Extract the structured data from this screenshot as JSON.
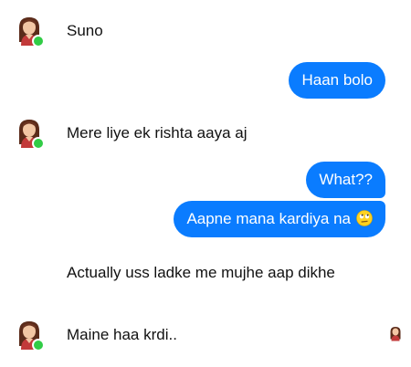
{
  "conversation": {
    "messages": [
      {
        "from": "them",
        "text": "Suno"
      },
      {
        "from": "me",
        "text": "Haan bolo"
      },
      {
        "from": "them",
        "text": "Mere liye ek rishta aaya aj"
      },
      {
        "from": "me",
        "text": "What??"
      },
      {
        "from": "me",
        "text": "Aapne mana kardiya na",
        "emoji": "face-with-rolling-eyes"
      },
      {
        "from": "them",
        "text": "Actually uss ladke me mujhe aap dikhe"
      },
      {
        "from": "them",
        "text": "Maine haa krdi.."
      }
    ]
  },
  "colors": {
    "outgoing_bubble": "#0a7cff",
    "outgoing_text": "#ffffff",
    "incoming_text": "#111111",
    "online_dot": "#31cc46",
    "background": "#ffffff"
  },
  "icons": {
    "avatar": "contact-avatar-icon",
    "online": "online-status-dot",
    "seen": "seen-avatar-icon",
    "emoji": "face-with-rolling-eyes"
  }
}
